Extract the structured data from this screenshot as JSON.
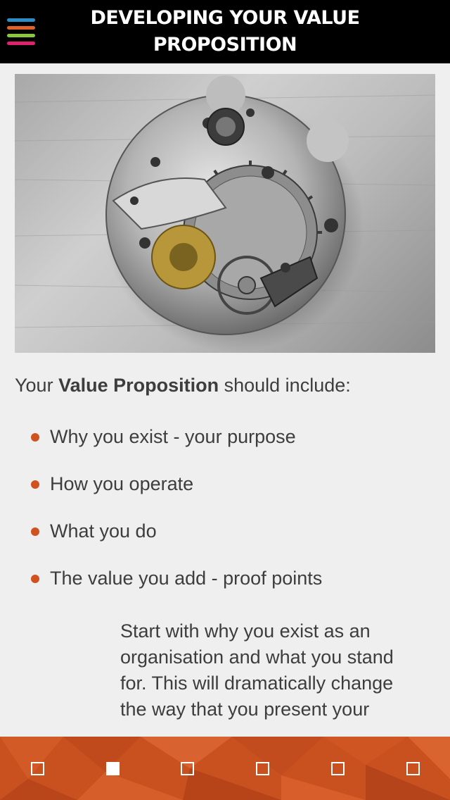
{
  "header": {
    "title": "DEVELOPING YOUR VALUE\nPROPOSITION",
    "menu_colors": [
      "#2a8fc6",
      "#e0622a",
      "#8cc63f",
      "#e0226e"
    ]
  },
  "hero": {
    "subject": "watch-movement-photo"
  },
  "intro": {
    "prefix": "Your ",
    "bold": "Value Proposition",
    "suffix": " should include:"
  },
  "bullets": [
    "Why you exist - your purpose",
    "How you operate",
    "What you do",
    "The value you add - proof points"
  ],
  "paragraph": "Start with why you exist as an organisation and what you stand for. This will dramatically change the way that you present your",
  "pagination": {
    "total": 6,
    "active_index": 1
  },
  "colors": {
    "accent": "#d0521f",
    "footer": "#c9501f"
  }
}
